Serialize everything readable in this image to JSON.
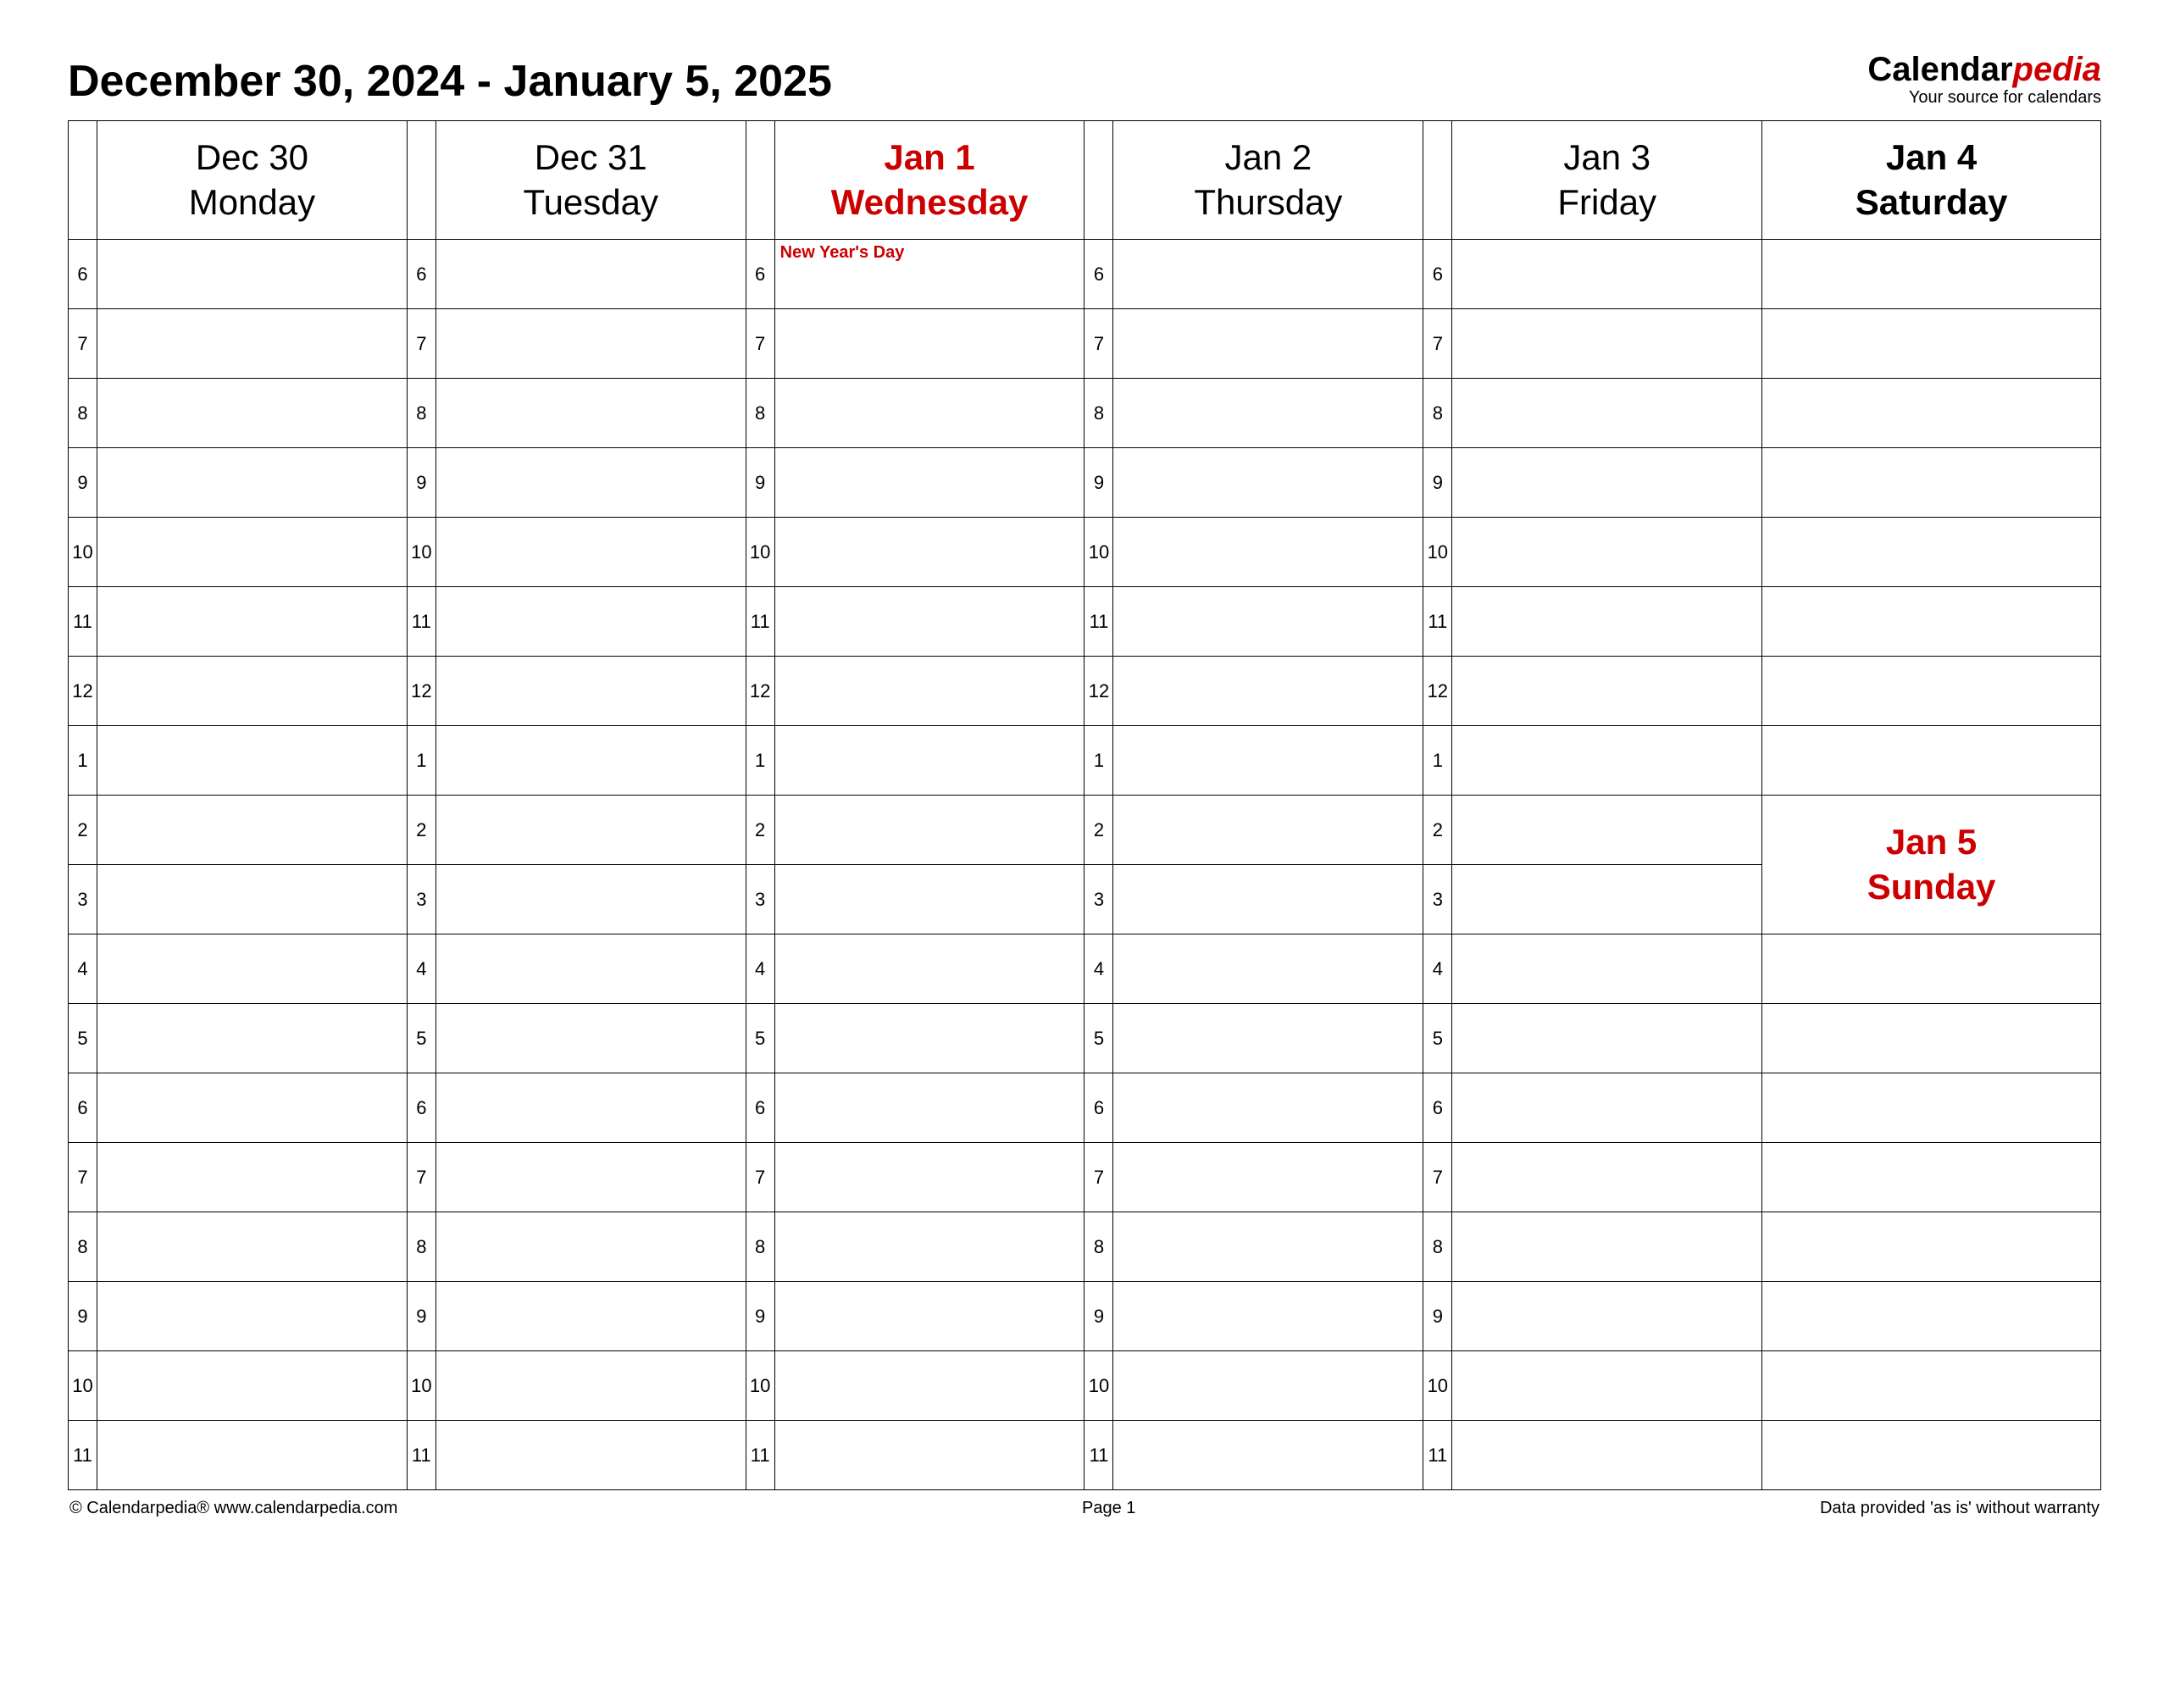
{
  "title": "December 30, 2024 - January 5, 2025",
  "logo": {
    "part1": "Calendar",
    "part2": "pedia",
    "sub": "Your source for calendars"
  },
  "hours": [
    "6",
    "7",
    "8",
    "9",
    "10",
    "11",
    "12",
    "1",
    "2",
    "3",
    "4",
    "5",
    "6",
    "7",
    "8",
    "9",
    "10",
    "11"
  ],
  "days": [
    {
      "date": "Dec 30",
      "name": "Monday",
      "highlight": false,
      "event": ""
    },
    {
      "date": "Dec 31",
      "name": "Tuesday",
      "highlight": false,
      "event": ""
    },
    {
      "date": "Jan 1",
      "name": "Wednesday",
      "highlight": true,
      "event": "New Year's Day"
    },
    {
      "date": "Jan 2",
      "name": "Thursday",
      "highlight": false,
      "event": ""
    },
    {
      "date": "Jan 3",
      "name": "Friday",
      "highlight": false,
      "event": ""
    }
  ],
  "saturday": {
    "date": "Jan 4",
    "name": "Saturday"
  },
  "sunday": {
    "date": "Jan 5",
    "name": "Sunday"
  },
  "footer": {
    "left": "© Calendarpedia®   www.calendarpedia.com",
    "center": "Page 1",
    "right": "Data provided 'as is' without warranty"
  }
}
